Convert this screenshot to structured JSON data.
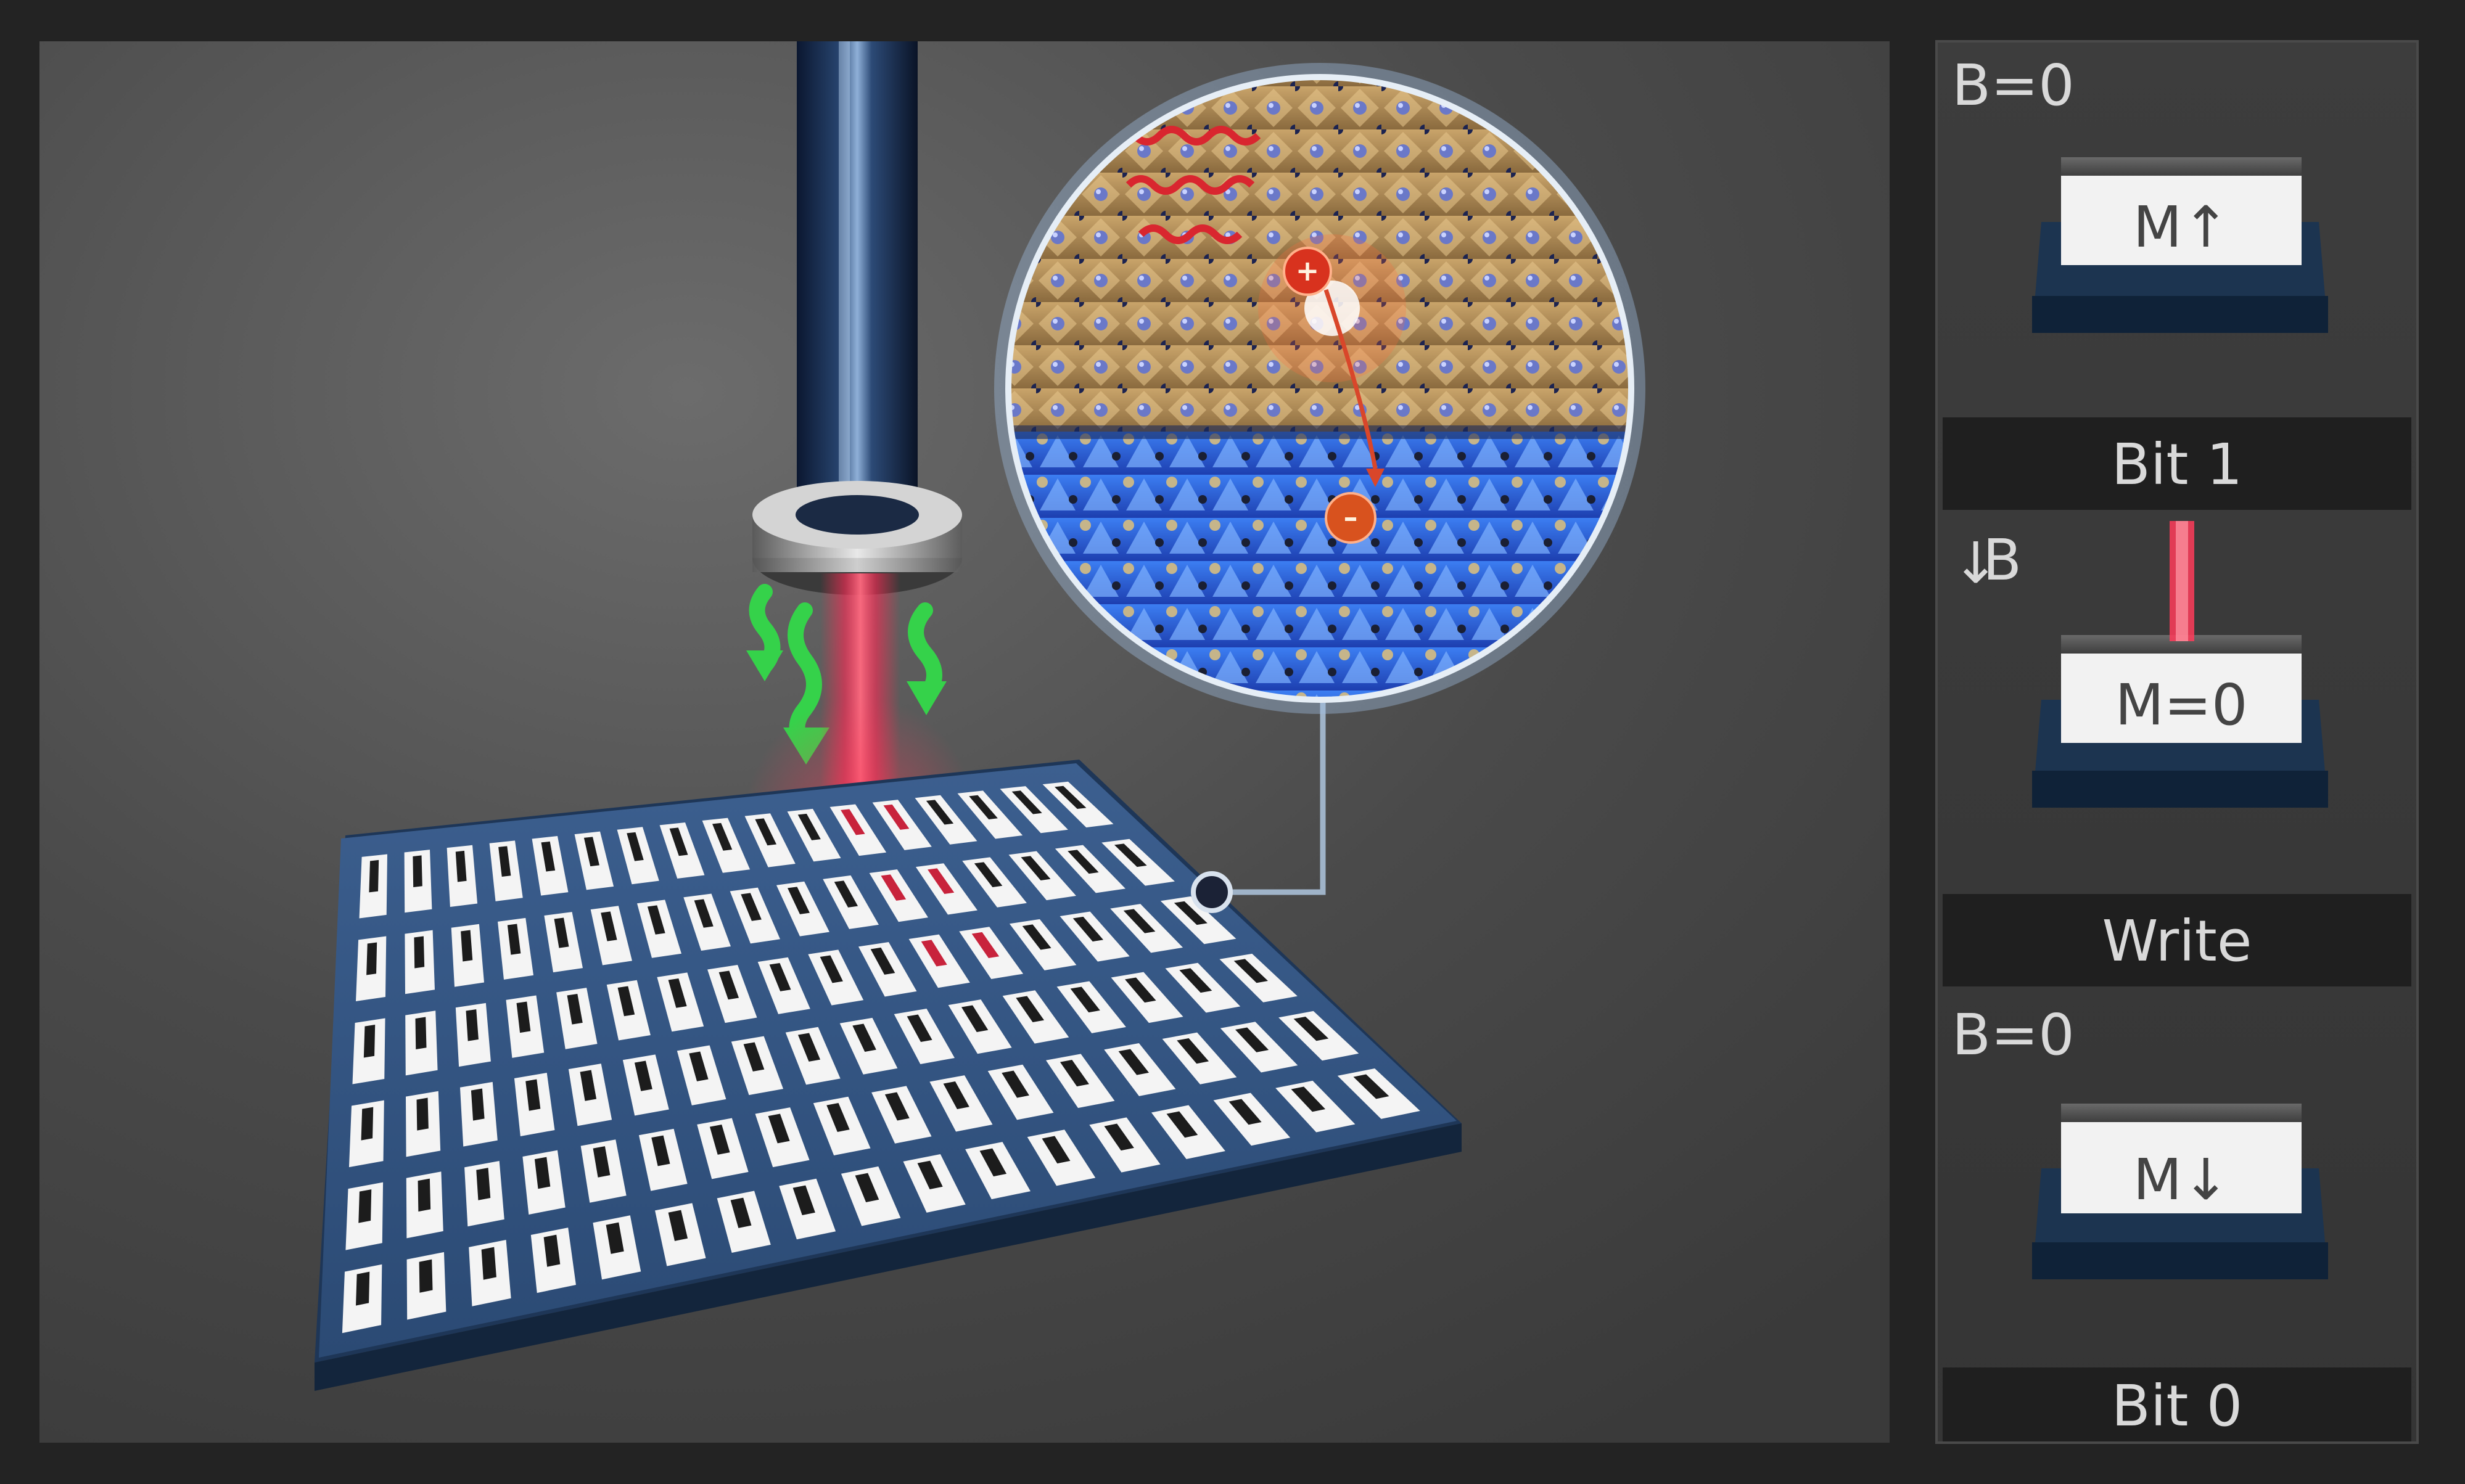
{
  "panels": {
    "top": {
      "field": "B=0",
      "cell": "M↑",
      "bar": "Bit 1"
    },
    "middle": {
      "arrow": "↓",
      "field": "B",
      "cell": "M=0",
      "bar": "Write"
    },
    "bottom": {
      "field": "B=0",
      "cell": "M↓",
      "bar": "Bit 0"
    }
  },
  "inset": {
    "hole_sign": "+",
    "electron_sign": "–"
  }
}
